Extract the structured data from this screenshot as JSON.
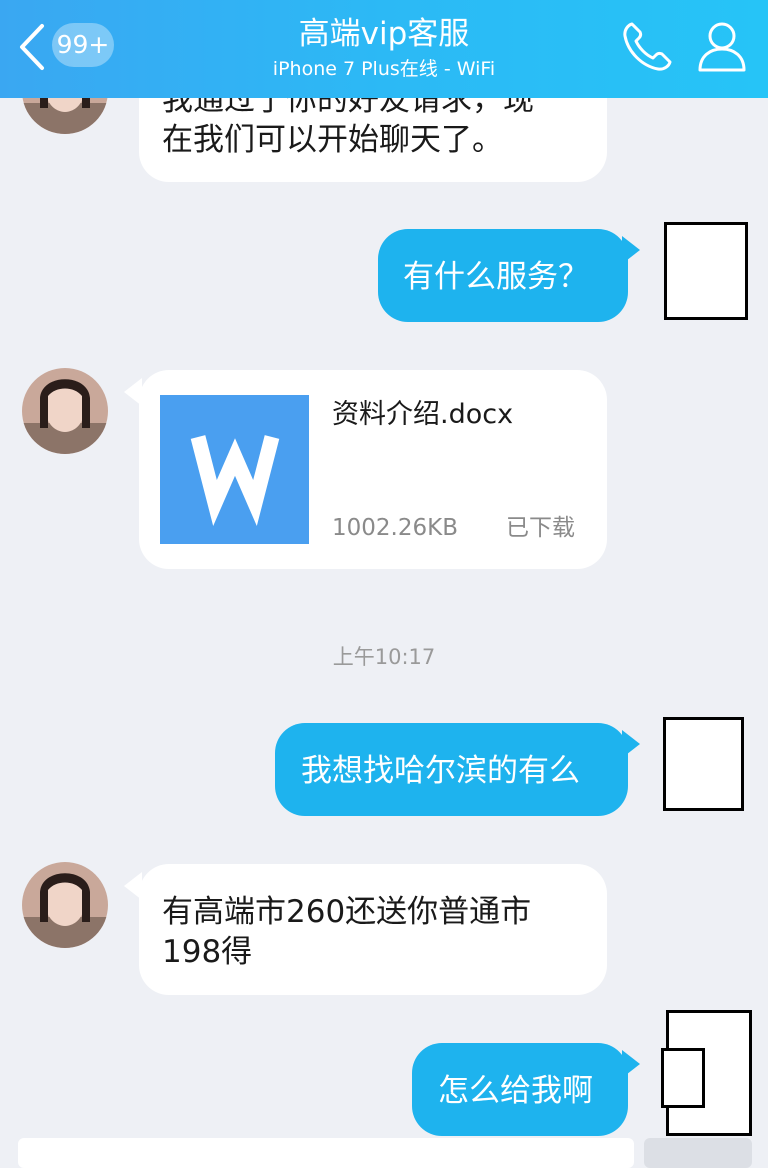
{
  "header": {
    "unread_badge": "99+",
    "title": "高端vip客服",
    "subtitle": "iPhone 7 Plus在线 - WiFi"
  },
  "messages": [
    {
      "side": "in",
      "text_line1": "我通过了你的好友请求，现",
      "text_line2": "在我们可以开始聊天了。"
    },
    {
      "side": "out",
      "text": "有什么服务？"
    },
    {
      "side": "in",
      "type": "file",
      "file_name": "资料介绍.docx",
      "file_size": "1002.26KB",
      "file_status": "已下载",
      "file_icon": "word-document-icon"
    },
    {
      "side": "out",
      "text": "我想找哈尔滨的有么"
    },
    {
      "side": "in",
      "text_line1": "有高端市260还送你普通市",
      "text_line2": "198得"
    },
    {
      "side": "out",
      "text": "怎么给我啊"
    }
  ],
  "timestamp": "上午10:17",
  "colors": {
    "header_gradient_start": "#3aa7f2",
    "header_gradient_end": "#26c4f7",
    "outgoing_bubble": "#1eb3ee",
    "incoming_bubble": "#ffffff",
    "background": "#eef0f5",
    "file_icon": "#4a9ff0"
  },
  "icons": {
    "back": "chevron-left-icon",
    "call": "phone-icon",
    "profile": "person-icon"
  }
}
